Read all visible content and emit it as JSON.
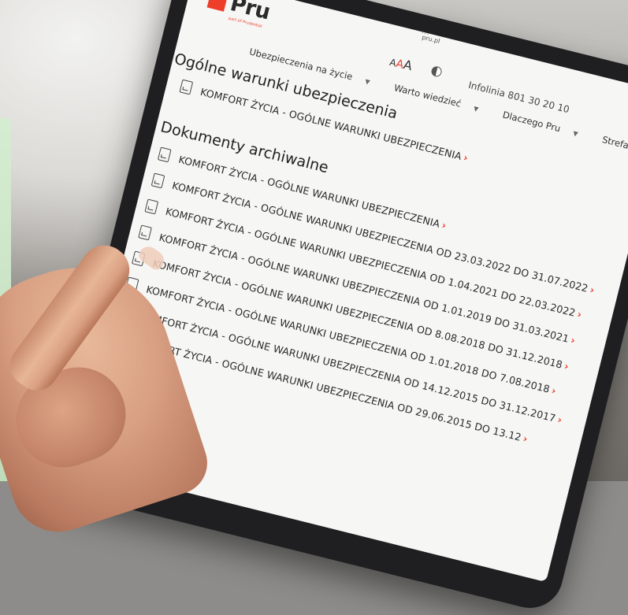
{
  "header": {
    "logo_text": "Pru",
    "url": "pru.pl",
    "font_size_control": [
      "A",
      "A",
      "A"
    ],
    "infolinia": "Infolinia 801 30 20 10"
  },
  "nav": {
    "items": [
      {
        "label": "Ubezpieczenia na życie"
      },
      {
        "label": "Warto wiedzieć"
      },
      {
        "label": "Dlaczego Pru"
      },
      {
        "label": "Strefa Klienta"
      }
    ]
  },
  "sections": {
    "current_title": "Ogólne warunki ubezpieczenia",
    "current_doc": "KOMFORT ŻYCIA - OGÓLNE WARUNKI UBEZPIECZENIA",
    "archive_title": "Dokumenty archiwalne",
    "archive_docs": [
      "KOMFORT ŻYCIA - OGÓLNE WARUNKI UBEZPIECZENIA",
      "KOMFORT ŻYCIA - OGÓLNE WARUNKI UBEZPIECZENIA OD 23.03.2022 DO 31.07.2022",
      "KOMFORT ŻYCIA - OGÓLNE WARUNKI UBEZPIECZENIA OD 1.04.2021 DO 22.03.2022",
      "KOMFORT ŻYCIA - OGÓLNE WARUNKI UBEZPIECZENIA OD 1.01.2019 DO 31.03.2021",
      "KOMFORT ŻYCIA - OGÓLNE WARUNKI UBEZPIECZENIA OD 8.08.2018 DO 31.12.2018",
      "KOMFORT ŻYCIA - OGÓLNE WARUNKI UBEZPIECZENIA OD 1.01.2018 DO 7.08.2018",
      "KOMFORT ŻYCIA - OGÓLNE WARUNKI UBEZPIECZENIA OD 14.12.2015 DO 31.12.2017",
      "KOMFORT ŻYCIA - OGÓLNE WARUNKI UBEZPIECZENIA OD 29.06.2015 DO 13.12"
    ]
  },
  "colors": {
    "brand": "#ed3e2a",
    "side_panel": "#cde6c9"
  },
  "icons": {
    "doc": "document-icon",
    "contrast": "contrast-icon",
    "link_arrow": "chevron-right-icon"
  }
}
